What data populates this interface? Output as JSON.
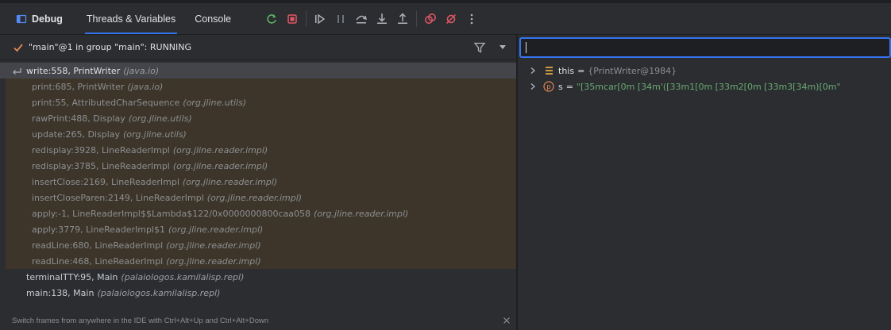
{
  "toolbar": {
    "title": "Debug",
    "tabs": [
      "Threads & Variables",
      "Console"
    ],
    "buttons": [
      "rerun-icon",
      "stop-icon",
      "resume-icon",
      "pause-icon",
      "step-over-icon",
      "step-into-icon",
      "step-out-icon",
      "view-breakpoints-icon",
      "mute-breakpoints-icon",
      "more-icon"
    ]
  },
  "thread": {
    "label": "\"main\"@1 in group \"main\": RUNNING"
  },
  "frames": [
    {
      "method": "write:558, PrintWriter",
      "pkg": "(java.io)",
      "kind": "current"
    },
    {
      "method": "print:685, PrintWriter",
      "pkg": "(java.io)",
      "kind": "lib"
    },
    {
      "method": "print:55, AttributedCharSequence",
      "pkg": "(org.jline.utils)",
      "kind": "lib"
    },
    {
      "method": "rawPrint:488, Display",
      "pkg": "(org.jline.utils)",
      "kind": "lib"
    },
    {
      "method": "update:265, Display",
      "pkg": "(org.jline.utils)",
      "kind": "lib"
    },
    {
      "method": "redisplay:3928, LineReaderImpl",
      "pkg": "(org.jline.reader.impl)",
      "kind": "lib"
    },
    {
      "method": "redisplay:3785, LineReaderImpl",
      "pkg": "(org.jline.reader.impl)",
      "kind": "lib"
    },
    {
      "method": "insertClose:2169, LineReaderImpl",
      "pkg": "(org.jline.reader.impl)",
      "kind": "lib"
    },
    {
      "method": "insertCloseParen:2149, LineReaderImpl",
      "pkg": "(org.jline.reader.impl)",
      "kind": "lib"
    },
    {
      "method": "apply:-1, LineReaderImpl$$Lambda$122/0x0000000800caa058",
      "pkg": "(org.jline.reader.impl)",
      "kind": "lib"
    },
    {
      "method": "apply:3779, LineReaderImpl$1",
      "pkg": "(org.jline.reader.impl)",
      "kind": "lib"
    },
    {
      "method": "readLine:680, LineReaderImpl",
      "pkg": "(org.jline.reader.impl)",
      "kind": "lib"
    },
    {
      "method": "readLine:468, LineReaderImpl",
      "pkg": "(org.jline.reader.impl)",
      "kind": "lib"
    },
    {
      "method": "terminalTTY:95, Main",
      "pkg": "(palaiologos.kamilalisp.repl)",
      "kind": "user"
    },
    {
      "method": "main:138, Main",
      "pkg": "(palaiologos.kamilalisp.repl)",
      "kind": "user"
    }
  ],
  "hint": "Switch frames from anywhere in the IDE with Ctrl+Alt+Up and Ctrl+Alt+Down",
  "evaluate": {
    "value": ""
  },
  "variables": [
    {
      "name": "this",
      "eq": "=",
      "value": "{PrintWriter@1984}",
      "type": "field",
      "icon": "field-icon"
    },
    {
      "name": "s",
      "eq": "=",
      "value": "\"[35mcar[0m [34m'([33m1[0m [33m2[0m [33m3[34m)[0m\"",
      "type": "string",
      "icon": "parameter-icon"
    }
  ],
  "colors": {
    "accent": "#3574f0",
    "library_frame_bg": "#3d3529",
    "string_value": "#6aab73"
  }
}
